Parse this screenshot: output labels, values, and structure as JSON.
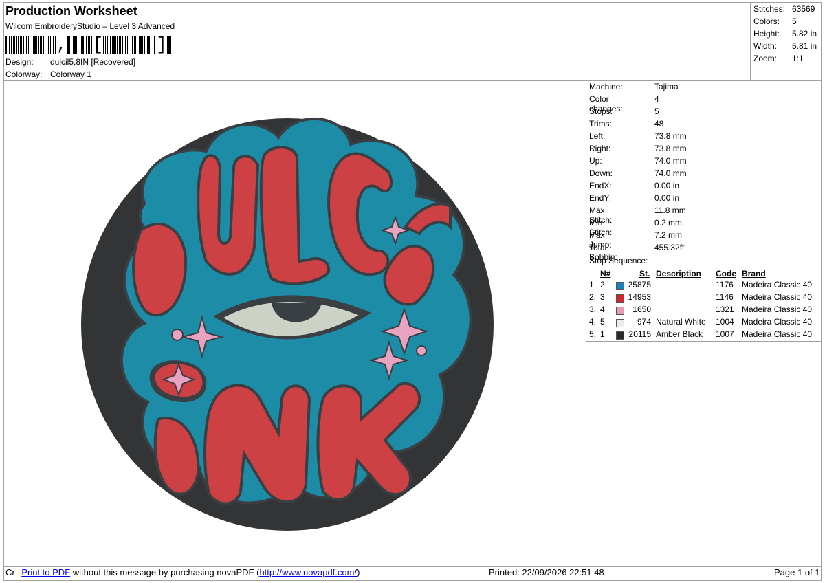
{
  "header": {
    "title": "Production Worksheet",
    "subtitle": "Wilcom EmbroideryStudio – Level 3 Advanced",
    "barcode_text": ",[]",
    "design_label": "Design:",
    "design_value": "dulcil5,8IN [Recovered]",
    "colorway_label": "Colorway:",
    "colorway_value": "Colorway 1"
  },
  "summary": [
    {
      "label": "Stitches:",
      "value": "63569"
    },
    {
      "label": "Colors:",
      "value": "5"
    },
    {
      "label": "Height:",
      "value": "5.82 in"
    },
    {
      "label": "Width:",
      "value": "5.81 in"
    },
    {
      "label": "Zoom:",
      "value": "1:1"
    }
  ],
  "machine_info": [
    {
      "label": "Machine:",
      "value": "Tajima"
    },
    {
      "label": "Color changes:",
      "value": "4"
    },
    {
      "label": "Stops:",
      "value": "5"
    },
    {
      "label": "Trims:",
      "value": "48"
    },
    {
      "label": "Left:",
      "value": "73.8 mm"
    },
    {
      "label": "Right:",
      "value": "73.8 mm"
    },
    {
      "label": "Up:",
      "value": "74.0 mm"
    },
    {
      "label": "Down:",
      "value": "74.0 mm"
    },
    {
      "label": "EndX:",
      "value": "0.00 in"
    },
    {
      "label": "EndY:",
      "value": "0.00 in"
    },
    {
      "label": "Max Stitch:",
      "value": "11.8 mm"
    },
    {
      "label": "Min Stitch:",
      "value": "0.2 mm"
    },
    {
      "label": "Max Jump:",
      "value": "7.2 mm"
    },
    {
      "label": "Total Bobbin:",
      "value": "455.32ft"
    }
  ],
  "stop_sequence": {
    "title": "Stop Sequence:",
    "columns": {
      "n": "N#",
      "st": "St.",
      "description": "Description",
      "code": "Code",
      "brand": "Brand"
    },
    "rows": [
      {
        "stop": "1.",
        "n": "2",
        "color": "#1a84b8",
        "st": "25875",
        "description": "",
        "code": "1176",
        "brand": "Madeira Classic 40"
      },
      {
        "stop": "2.",
        "n": "3",
        "color": "#d3262b",
        "st": "14953",
        "description": "",
        "code": "1146",
        "brand": "Madeira Classic 40"
      },
      {
        "stop": "3.",
        "n": "4",
        "color": "#e79ab8",
        "st": "1650",
        "description": "",
        "code": "1321",
        "brand": "Madeira Classic 40"
      },
      {
        "stop": "4.",
        "n": "5",
        "color": "#ebebf0",
        "st": "974",
        "description": "Natural White",
        "code": "1004",
        "brand": "Madeira Classic 40"
      },
      {
        "stop": "5.",
        "n": "1",
        "color": "#2a2a2a",
        "st": "20115",
        "description": "Amber Black",
        "code": "1007",
        "brand": "Madeira Classic 40"
      }
    ]
  },
  "footer": {
    "prefix": "Cr",
    "print_link": "Print to PDF",
    "message": " without this message by purchasing novaPDF (",
    "url": "http://www.novapdf.com/",
    "suffix": ")",
    "printed": "Printed: 22/09/2026 22:51:48",
    "page": "Page 1 of 1"
  },
  "design_preview": {
    "colors": {
      "outer": "#333436",
      "teal": "#1d8ca6",
      "red": "#cd4144",
      "outline": "#3a3f44",
      "pink": "#e7a3bf",
      "eye_white": "#cdd2c6"
    }
  }
}
